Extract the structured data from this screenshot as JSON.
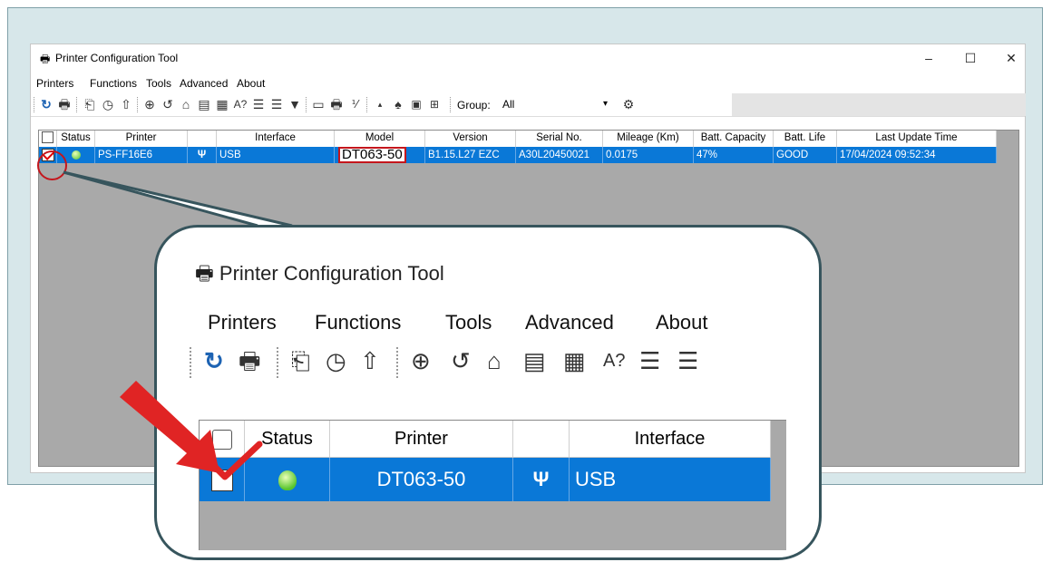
{
  "window": {
    "title": "Printer Configuration Tool",
    "controls": {
      "minimize": "–",
      "maximize": "☐",
      "close": "✕"
    }
  },
  "menu": [
    "Printers",
    "Functions",
    "Tools",
    "Advanced",
    "About"
  ],
  "toolbar": {
    "icons": [
      "refresh-icon",
      "printer-settings-icon",
      "feed-icon",
      "clock-icon",
      "cloud-upload-icon",
      "calibrate-icon",
      "reset-icon",
      "home-icon",
      "command-icon",
      "file-icon",
      "font-icon",
      "list-in-icon",
      "list-out-icon",
      "diamond-icon",
      "terminal-icon",
      "printer-icon",
      "ratio-icon",
      "small-icon",
      "bell-icon",
      "image-icon",
      "config-icon"
    ],
    "group_label": "Group:",
    "group_value": "All",
    "gear": "⚙"
  },
  "table": {
    "columns": [
      "Status",
      "Printer",
      "",
      "Interface",
      "Model",
      "Version",
      "Serial No.",
      "Mileage (Km)",
      "Batt. Capacity",
      "Batt. Life",
      "Last Update Time"
    ],
    "row": {
      "printer": "PS-FF16E6",
      "usb_symbol": "Ψ",
      "interface": "USB",
      "model": "DT063-50",
      "version": "B1.15.L27 EZC",
      "serial": "A30L20450021",
      "mileage": "0.0175",
      "batt_capacity": "47%",
      "batt_life": "GOOD",
      "last_update": "17/04/2024 09:52:34"
    }
  },
  "zoom": {
    "title": "Printer Configuration Tool",
    "menu": [
      "Printers",
      "Functions",
      "Tools",
      "Advanced",
      "About"
    ],
    "columns": [
      "Status",
      "Printer",
      "",
      "Interface"
    ],
    "row": {
      "printer": "DT063-50",
      "usb_symbol": "Ψ",
      "interface": "USB"
    }
  },
  "colors": {
    "selection": "#0a78d7",
    "highlight_red": "#c4161c",
    "frame_bg": "#d7e7ea",
    "callout_border": "#37555d"
  }
}
